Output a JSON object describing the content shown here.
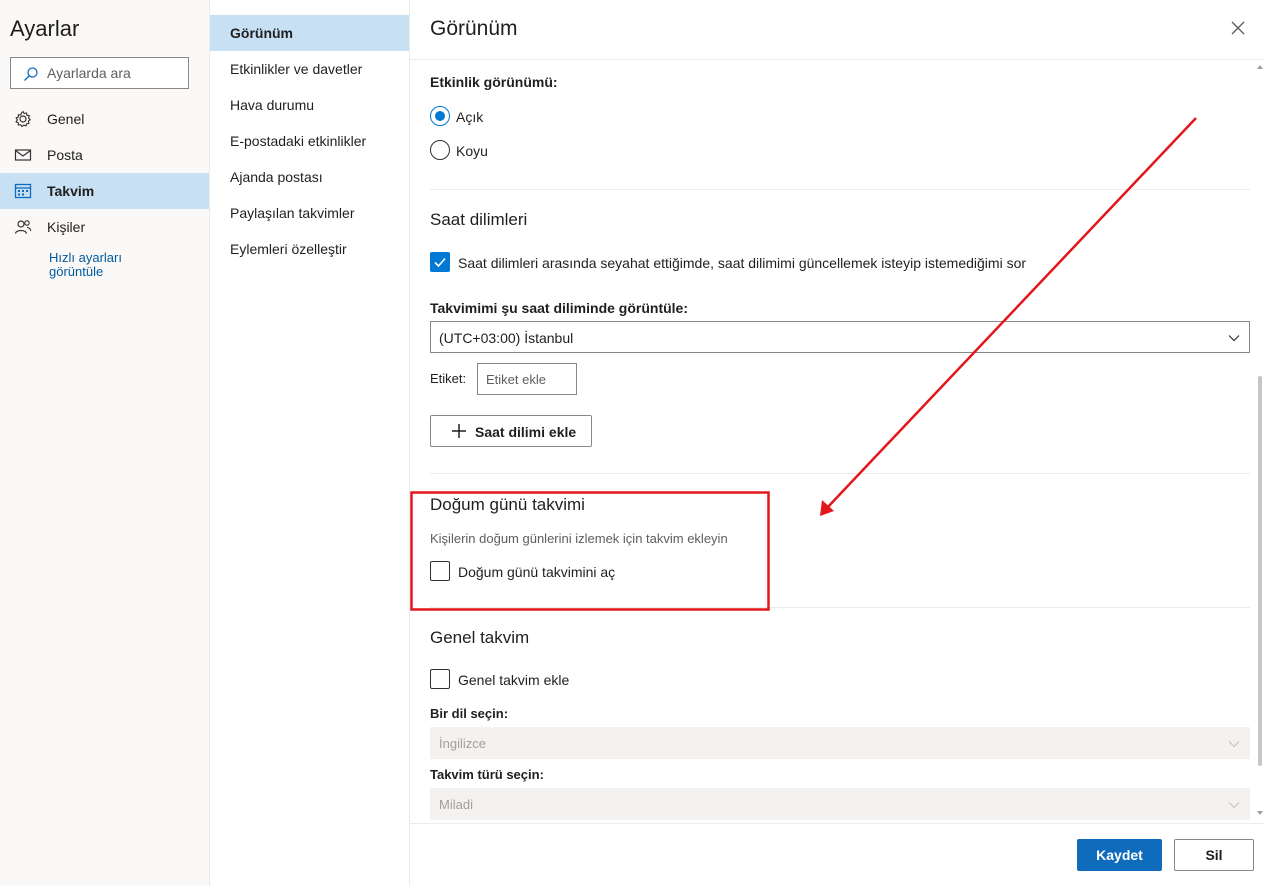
{
  "sidebar": {
    "title": "Ayarlar",
    "search_placeholder": "Ayarlarda ara",
    "items": [
      {
        "label": "Genel",
        "icon": "gear-icon"
      },
      {
        "label": "Posta",
        "icon": "mail-icon"
      },
      {
        "label": "Takvim",
        "icon": "calendar-icon",
        "active": true
      },
      {
        "label": "Kişiler",
        "icon": "people-icon"
      }
    ],
    "quick_settings": "Hızlı ayarları görüntüle"
  },
  "submenu": {
    "items": [
      {
        "label": "Görünüm",
        "active": true
      },
      {
        "label": "Etkinlikler ve davetler"
      },
      {
        "label": "Hava durumu"
      },
      {
        "label": "E-postadaki etkinlikler"
      },
      {
        "label": "Ajanda postası"
      },
      {
        "label": "Paylaşılan takvimler"
      },
      {
        "label": "Eylemleri özelleştir"
      }
    ]
  },
  "panel": {
    "title": "Görünüm",
    "event_appearance": {
      "label": "Etkinlik görünümü:",
      "options": [
        {
          "label": "Açık",
          "selected": true
        },
        {
          "label": "Koyu",
          "selected": false
        }
      ]
    },
    "time_zones": {
      "heading": "Saat dilimleri",
      "travel_checkbox": {
        "label": "Saat dilimleri arasında seyahat ettiğimde, saat dilimimi güncellemek isteyip istemediğimi sor",
        "checked": true
      },
      "display_label": "Takvimimi şu saat diliminde görüntüle:",
      "selected_zone": "(UTC+03:00) İstanbul",
      "tag_label": "Etiket:",
      "tag_placeholder": "Etiket ekle",
      "add_zone_button": "Saat dilimi ekle"
    },
    "birthday_calendar": {
      "heading": "Doğum günü takvimi",
      "description": "Kişilerin doğum günlerini izlemek için takvim ekleyin",
      "checkbox": {
        "label": "Doğum günü takvimini aç",
        "checked": false
      }
    },
    "public_calendar": {
      "heading": "Genel takvim",
      "checkbox": {
        "label": "Genel takvim ekle",
        "checked": false
      },
      "language_label": "Bir dil seçin:",
      "language_value": "İngilizce",
      "type_label": "Takvim türü seçin:",
      "type_value": "Miladi"
    }
  },
  "footer": {
    "save_label": "Kaydet",
    "discard_label": "Sil"
  },
  "colors": {
    "accent": "#0078d4",
    "active_nav": "#c7e0f4",
    "annotation": "#e3161b"
  }
}
